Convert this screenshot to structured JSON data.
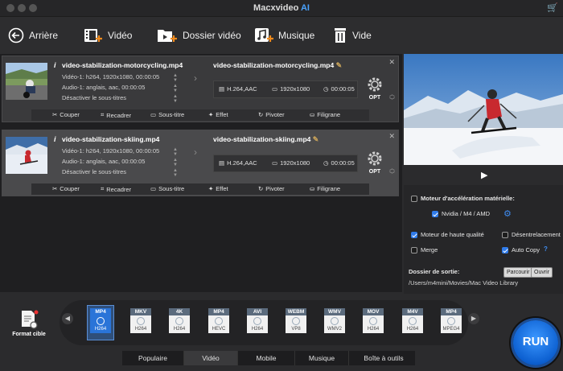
{
  "app": {
    "title_main": "Macxvideo",
    "title_ai": "AI"
  },
  "toolbar": {
    "back": "Arrière",
    "video": "Vidéo",
    "folder": "Dossier vidéo",
    "music": "Musique",
    "clear": "Vide"
  },
  "items": [
    {
      "source_name": "video-stabilization-motorcycling.mp4",
      "video_info": "Vidéo-1: h264, 1920x1080, 00:00:05",
      "audio_info": "Audio-1: anglais, aac, 00:00:05",
      "subtitle": "Désactiver le sous-titres",
      "output_name": "video-stabilization-motorcycling.mp4",
      "codec": "H.264,AAC",
      "resolution": "1920x1080",
      "duration": "00:00:05",
      "opt": "OPT"
    },
    {
      "source_name": "video-stabilization-skiing.mp4",
      "video_info": "Vidéo-1: h264, 1920x1080, 00:00:05",
      "audio_info": "Audio-1: anglais, aac, 00:00:05",
      "subtitle": "Désactiver le sous-titres",
      "output_name": "video-stabilization-skiing.mp4",
      "codec": "H.264,AAC",
      "resolution": "1920x1080",
      "duration": "00:00:05",
      "opt": "OPT"
    }
  ],
  "edit_tools": {
    "cut": "Couper",
    "crop": "Recadrer",
    "subtitle": "Sous-titre",
    "effect": "Effet",
    "rotate": "Pivoter",
    "watermark": "Filigrane"
  },
  "settings": {
    "hw_accel": "Moteur d'accélération matérielle:",
    "hw_option": "Nvidia / M4 / AMD",
    "high_quality": "Moteur de haute qualité",
    "deinterlace": "Désentrelacement",
    "merge": "Merge",
    "auto_copy": "Auto Copy",
    "help": "?",
    "output_label": "Dossier de sortie:",
    "browse": "Parcourir",
    "open": "Ouvrir",
    "output_path": "/Users/m4mini/Movies/Mac Video Library"
  },
  "target": {
    "label": "Format cible"
  },
  "formats": [
    {
      "tag": "MP4",
      "sub": "H264"
    },
    {
      "tag": "MKV",
      "sub": "H264"
    },
    {
      "tag": "4K",
      "sub": "H264"
    },
    {
      "tag": "MP4",
      "sub": "HEVC"
    },
    {
      "tag": "AVI",
      "sub": "H264"
    },
    {
      "tag": "WEBM",
      "sub": "VP8"
    },
    {
      "tag": "WMV",
      "sub": "WMV2"
    },
    {
      "tag": "MOV",
      "sub": "H264"
    },
    {
      "tag": "M4V",
      "sub": "H264"
    },
    {
      "tag": "MP4",
      "sub": "MPEG4"
    }
  ],
  "tabs": [
    "Populaire",
    "Vidéo",
    "Mobile",
    "Musique",
    "Boîte à outils"
  ],
  "run": "RUN",
  "colors": {
    "accent": "#2f7bea",
    "opt_gear": "#cfcfcf"
  }
}
